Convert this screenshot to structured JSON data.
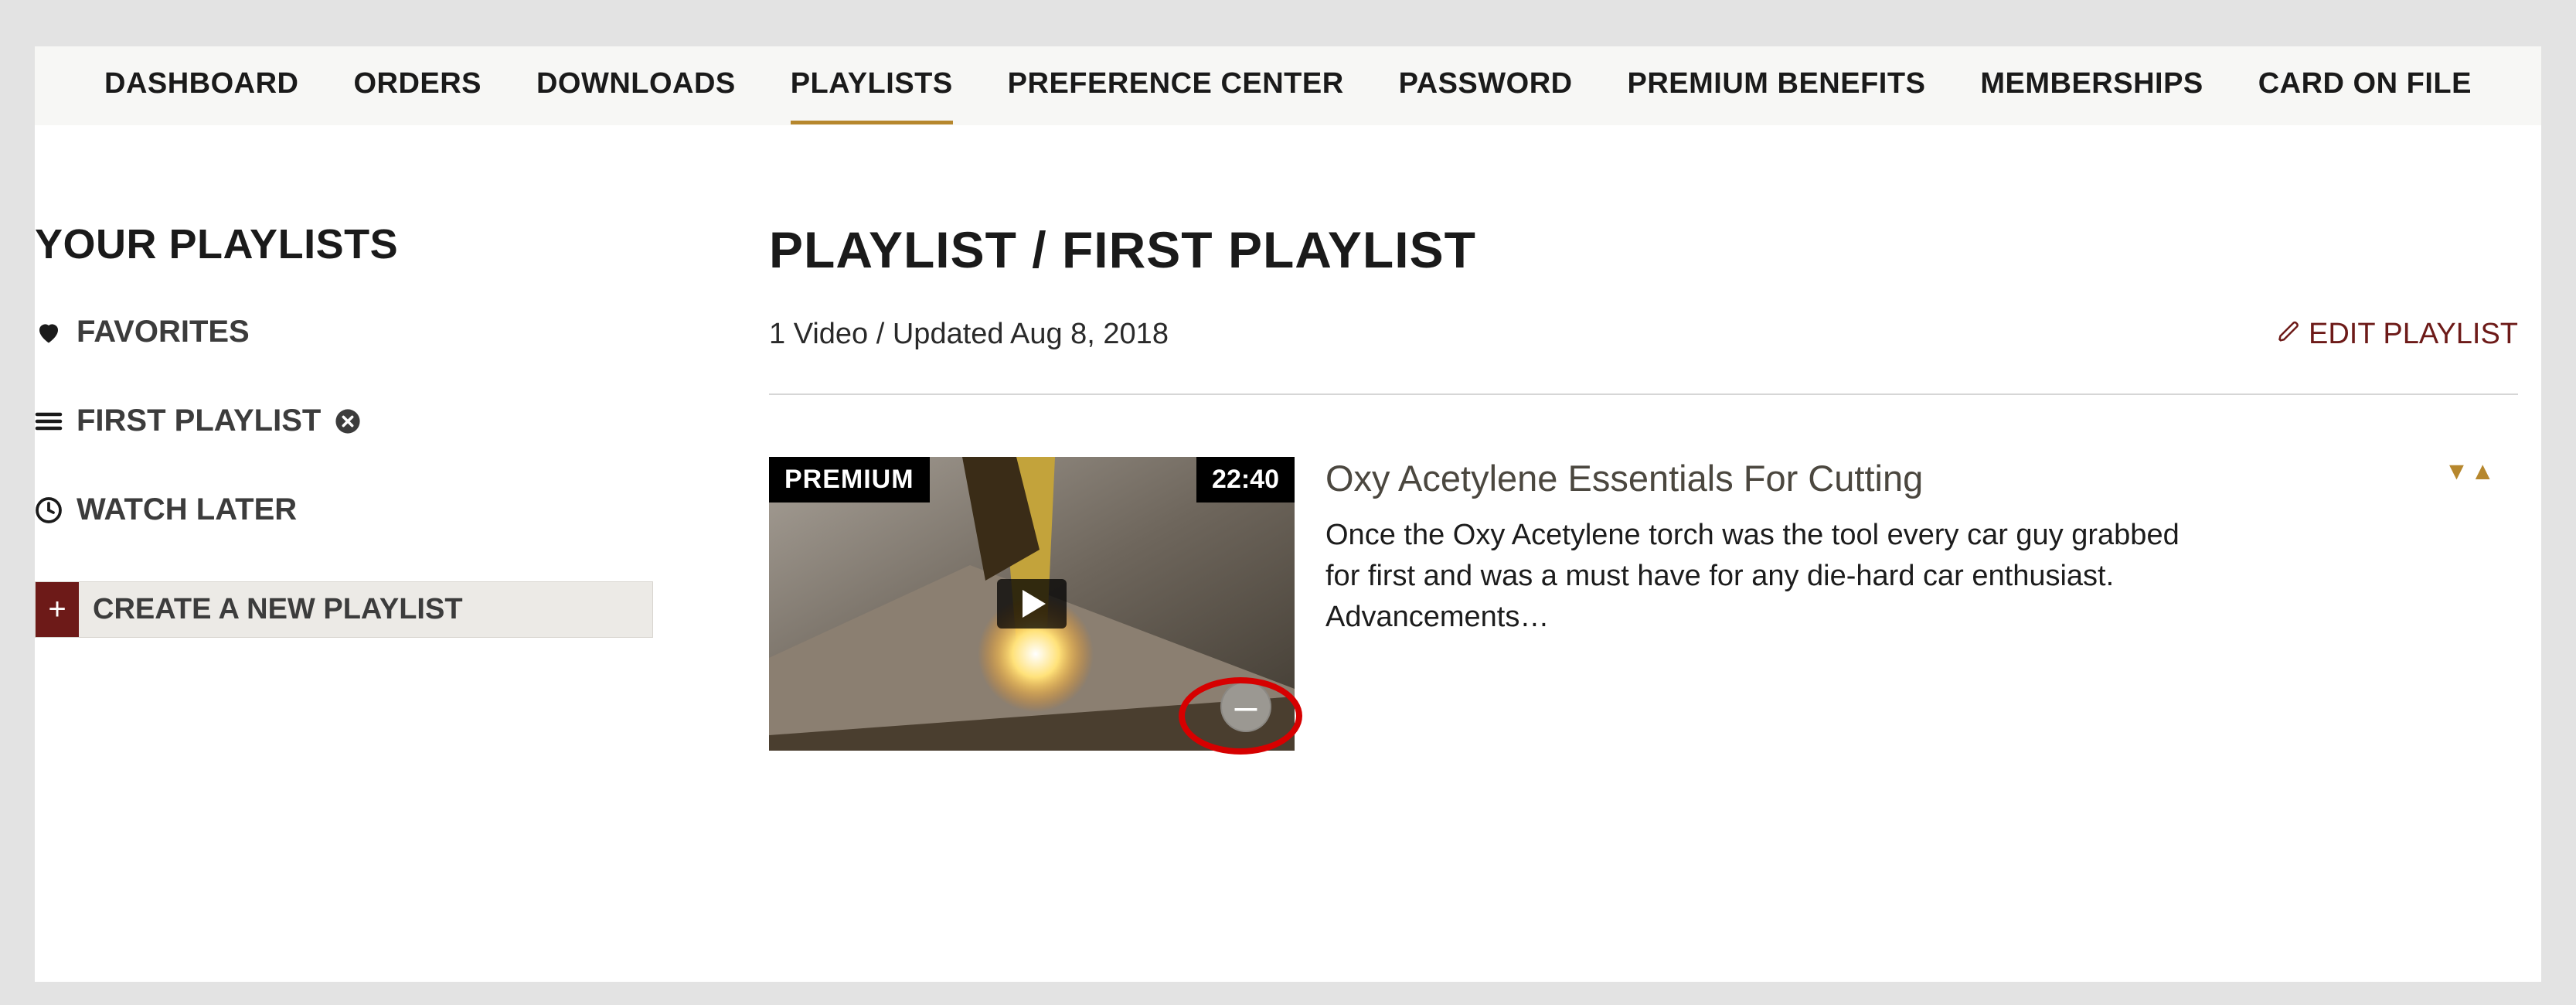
{
  "nav": {
    "items": [
      {
        "label": "DASHBOARD",
        "active": false
      },
      {
        "label": "ORDERS",
        "active": false
      },
      {
        "label": "DOWNLOADS",
        "active": false
      },
      {
        "label": "PLAYLISTS",
        "active": true
      },
      {
        "label": "PREFERENCE CENTER",
        "active": false
      },
      {
        "label": "PASSWORD",
        "active": false
      },
      {
        "label": "PREMIUM BENEFITS",
        "active": false
      },
      {
        "label": "MEMBERSHIPS",
        "active": false
      },
      {
        "label": "CARD ON FILE",
        "active": false
      }
    ]
  },
  "sidebar": {
    "title": "YOUR PLAYLISTS",
    "items": [
      {
        "icon": "heart",
        "label": "FAVORITES",
        "removable": false
      },
      {
        "icon": "list",
        "label": "FIRST PLAYLIST",
        "removable": true
      },
      {
        "icon": "clock",
        "label": "WATCH LATER",
        "removable": false
      }
    ],
    "create_label": "CREATE A NEW PLAYLIST"
  },
  "playlist": {
    "heading": "PLAYLIST / FIRST PLAYLIST",
    "meta": "1 Video / Updated Aug 8, 2018",
    "edit_label": "EDIT PLAYLIST"
  },
  "video": {
    "premium_badge": "PREMIUM",
    "duration": "22:40",
    "title": "Oxy Acetylene Essentials For Cutting",
    "description": "Once the Oxy Acetylene torch was the tool every car guy grabbed for first and was a must have for any die-hard car enthusiast. Advancements…",
    "remove_label": "–"
  },
  "colors": {
    "accent_gold": "#b6872d",
    "accent_maroon": "#6d1a18",
    "annotation_red": "#d60000"
  }
}
